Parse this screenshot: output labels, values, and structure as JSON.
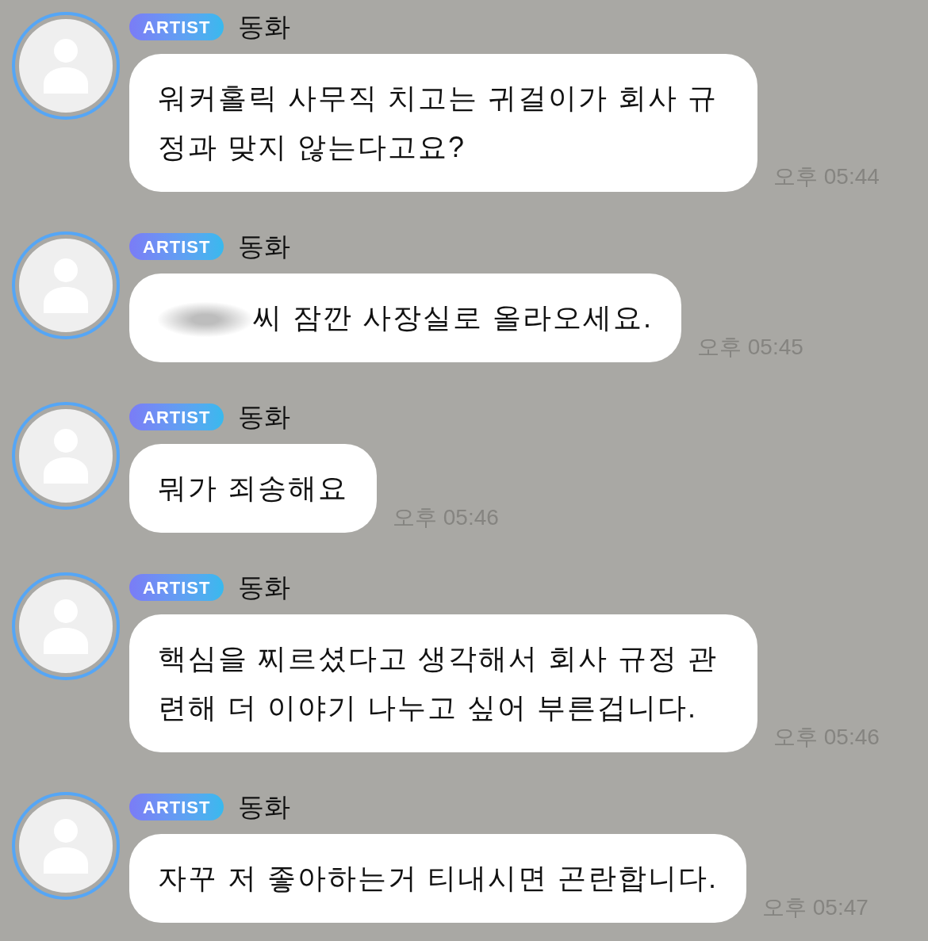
{
  "messages": [
    {
      "badge": "ARTIST",
      "sender": "동화",
      "redacted_name": false,
      "text": "워커홀릭 사무직 치고는 귀걸이가 회사 규정과 맞지 않는다고요?",
      "time": "오후 05:44"
    },
    {
      "badge": "ARTIST",
      "sender": "동화",
      "redacted_name": true,
      "text": "씨 잠깐 사장실로 올라오세요.",
      "time": "오후 05:45"
    },
    {
      "badge": "ARTIST",
      "sender": "동화",
      "redacted_name": false,
      "text": "뭐가 죄송해요",
      "time": "오후 05:46"
    },
    {
      "badge": "ARTIST",
      "sender": "동화",
      "redacted_name": false,
      "text": "핵심을 찌르셨다고 생각해서 회사 규정 관련해 더 이야기 나누고 싶어 부른겁니다.",
      "time": "오후 05:46"
    },
    {
      "badge": "ARTIST",
      "sender": "동화",
      "redacted_name": false,
      "text": "자꾸 저 좋아하는거 티내시면 곤란합니다.",
      "time": "오후 05:47"
    }
  ]
}
